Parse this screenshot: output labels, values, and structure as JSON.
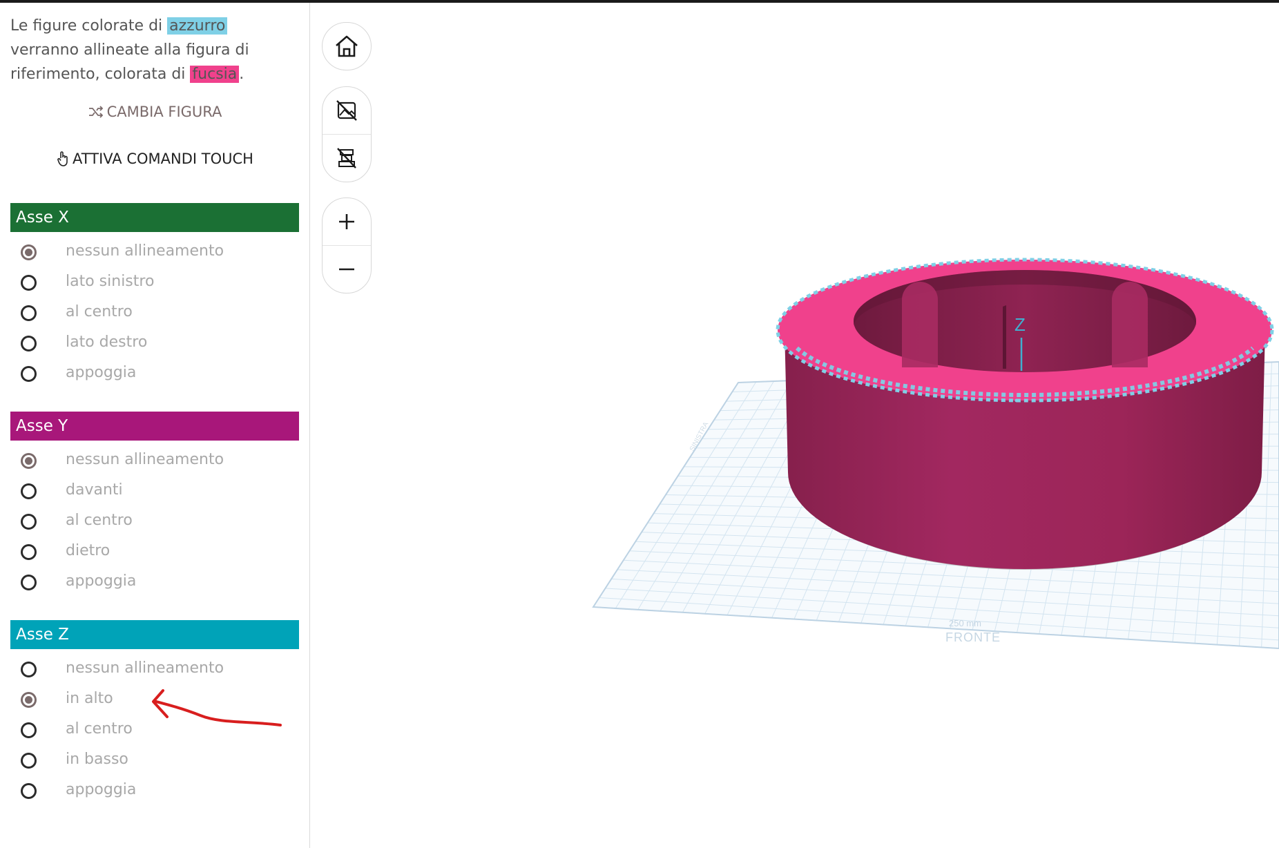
{
  "intro": {
    "part1": "Le figure colorate di ",
    "blue_word": "azzurro",
    "part2": " verranno allineate alla figura di riferimento, colorata di ",
    "pink_word": "fucsia",
    "part3": "."
  },
  "actions": {
    "shuffle_label": "CAMBIA FIGURA",
    "touch_label": "ATTIVA COMANDI TOUCH"
  },
  "axes": {
    "x": {
      "title": "Asse X",
      "color": "#1b7034",
      "options": [
        "nessun allineamento",
        "lato sinistro",
        "al centro",
        "lato destro",
        "appoggia"
      ],
      "selected": 0
    },
    "y": {
      "title": "Asse Y",
      "color": "#a8177a",
      "options": [
        "nessun allineamento",
        "davanti",
        "al centro",
        "dietro",
        "appoggia"
      ],
      "selected": 0
    },
    "z": {
      "title": "Asse Z",
      "color": "#00a3b8",
      "options": [
        "nessun allineamento",
        "in alto",
        "al centro",
        "in basso",
        "appoggia"
      ],
      "selected": 1
    }
  },
  "toolbar": {
    "icons": [
      "home-icon",
      "hide-images-icon",
      "hide-stack-icon",
      "zoom-in-icon",
      "zoom-out-icon"
    ]
  },
  "scene": {
    "axis_label": "Z",
    "plate_front_label": "FRONTE",
    "plate_size_label": "250 mm",
    "plate_side_label": "SINISTRA",
    "body_color": "#9c2558",
    "top_color": "#f0418c",
    "outline_color": "#7fd0e6"
  }
}
